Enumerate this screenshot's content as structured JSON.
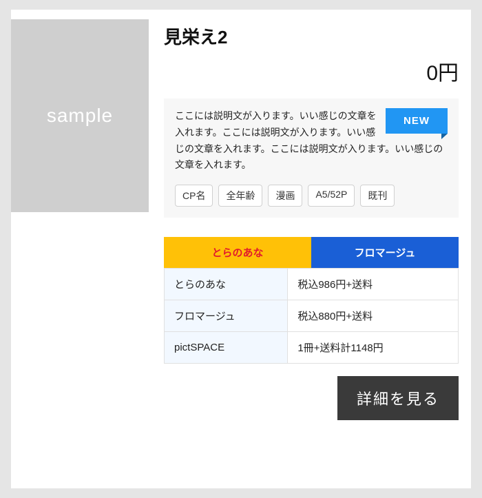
{
  "thumb_label": "sample",
  "title": "見栄え2",
  "price": "0円",
  "badge": "NEW",
  "description": "ここには説明文が入ります。いい感じの文章を入れます。ここには説明文が入ります。いい感じの文章を入れます。ここには説明文が入ります。いい感じの文章を入れます。",
  "tags": [
    "CP名",
    "全年齢",
    "漫画",
    "A5/52P",
    "既刊"
  ],
  "tabs": [
    {
      "label": "とらのあな",
      "active": true
    },
    {
      "label": "フロマージュ",
      "active": false
    }
  ],
  "price_rows": [
    {
      "vendor": "とらのあな",
      "price": "税込986円+送料"
    },
    {
      "vendor": "フロマージュ",
      "price": "税込880円+送料"
    },
    {
      "vendor": "pictSPACE",
      "price": "1冊+送料計1148円"
    }
  ],
  "cta": "詳細を見る"
}
